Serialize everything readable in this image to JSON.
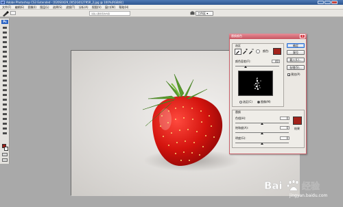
{
  "window": {
    "title": "Adobe Photoshop CS3 Extended - [020S0429_0052G012795R_2.jpg @ 100%(RGB/8)]",
    "app_badge": "Ps"
  },
  "menu": [
    "文件(F)",
    "编辑(E)",
    "图像(I)",
    "图层(L)",
    "选择(S)",
    "滤镜(T)",
    "分析(A)",
    "视图(V)",
    "窗口(W)",
    "帮助(H)"
  ],
  "options_bar": {
    "search_placeholder": "请输入要搜索的内容",
    "workspace_label": "工作区 ▾"
  },
  "tools_panel": {
    "logo": "Ps",
    "foreground_color": "#a0201a",
    "background_color": "#ffffff"
  },
  "dialog": {
    "title": "替换颜色",
    "close_icon": "close-icon",
    "selection_group": "选区",
    "color_label": "颜色:",
    "fuzziness_label": "颜色容差(F):",
    "fuzziness_value": "40",
    "radio_selection": "选区(C)",
    "radio_image": "图像(M)",
    "replace_group": "替换",
    "hue_label": "色相(H):",
    "hue_value": "0",
    "saturation_label": "饱和度(A):",
    "saturation_value": "0",
    "lightness_label": "明度(G):",
    "lightness_value": "0",
    "result_label": "结果",
    "ok_label": "确定",
    "cancel_label": "复位",
    "load_label": "载入(L)...",
    "save_label": "存储(S)...",
    "preview_label": "预览(P)",
    "sample_color": "#a3221b",
    "result_color": "#a3221b"
  },
  "watermark": {
    "brand": "Bai 经验",
    "url": "jingyan.baidu.com"
  }
}
